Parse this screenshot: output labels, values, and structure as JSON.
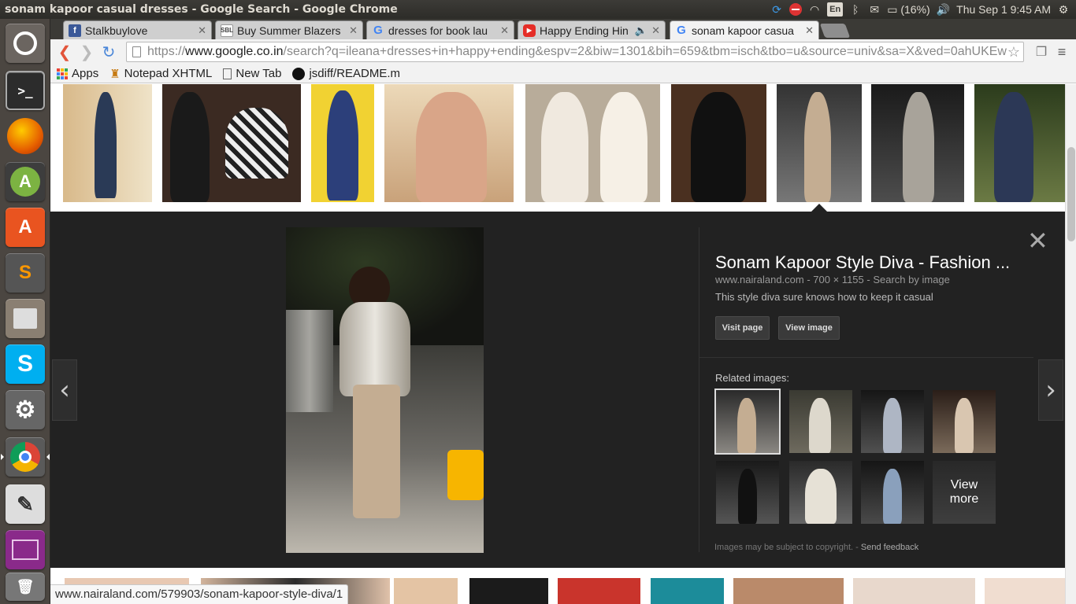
{
  "os": {
    "window_title": "sonam kapoor casual dresses - Google Search - Google Chrome",
    "tray": {
      "keyboard_layout": "En",
      "battery": "(16%)",
      "datetime": "Thu Sep  1  9:45 AM"
    }
  },
  "browser": {
    "tabs": [
      {
        "label": "Stalkbuylove",
        "favicon": "facebook-icon",
        "color": "#3b5998",
        "active": false
      },
      {
        "label": "Buy Summer Blazers",
        "favicon": "sbl-icon",
        "color": "#444444",
        "active": false
      },
      {
        "label": "dresses for book lau",
        "favicon": "google-icon",
        "color": "#4285f4",
        "active": false
      },
      {
        "label": "Happy Ending Hin",
        "favicon": "youtube-icon",
        "color": "#e52d27",
        "active": false
      },
      {
        "label": "sonam kapoor casua",
        "favicon": "google-icon",
        "color": "#4285f4",
        "active": true
      }
    ],
    "url": {
      "scheme": "https://",
      "host": "www.google.co.in",
      "path": "/search?q=ileana+dresses+in+happy+ending&espv=2&biw=1301&bih=659&tbm=isch&tbo=u&source=univ&sa=X&ved=0ahUKEw"
    },
    "bookmarks": [
      {
        "label": "Apps",
        "icon": "apps-grid-icon"
      },
      {
        "label": "Notepad XHTML",
        "icon": "notepad-icon"
      },
      {
        "label": "New Tab",
        "icon": "page-icon"
      },
      {
        "label": "jsdiff/README.m",
        "icon": "github-icon"
      }
    ],
    "status_url": "www.nairaland.com/579903/sonam-kapoor-style-diva/1"
  },
  "launcher": [
    {
      "name": "ubuntu-dash",
      "icon": "ubuntu-icon",
      "color": "#6b6560"
    },
    {
      "name": "terminal",
      "icon": "terminal-icon",
      "color": "#2c2c2c"
    },
    {
      "name": "firefox",
      "icon": "firefox-icon",
      "color": "#e66000"
    },
    {
      "name": "android-studio",
      "icon": "android-icon",
      "color": "#7cb342"
    },
    {
      "name": "software-center",
      "icon": "software-center-icon",
      "color": "#e95420"
    },
    {
      "name": "sublime-text",
      "icon": "sublime-icon",
      "color": "#555555"
    },
    {
      "name": "file-archive",
      "icon": "archive-icon",
      "color": "#8a7f72"
    },
    {
      "name": "skype",
      "icon": "skype-icon",
      "color": "#00aff0"
    },
    {
      "name": "system-settings",
      "icon": "settings-icon",
      "color": "#666666"
    },
    {
      "name": "chrome",
      "icon": "chrome-icon",
      "color": "#5a5a5a"
    },
    {
      "name": "text-editor",
      "icon": "text-editor-icon",
      "color": "#dddddd"
    },
    {
      "name": "workspace-switcher",
      "icon": "workspace-icon",
      "color": "#8a2a8a"
    },
    {
      "name": "trash",
      "icon": "trash-icon",
      "color": "#777777"
    }
  ],
  "preview": {
    "title": "Sonam Kapoor Style Diva - Fashion ...",
    "source": "www.nairaland.com",
    "dimensions": "700 × 1155",
    "search_by_image": "Search by image",
    "description": "This style diva sure knows how to keep it casual",
    "visit_page": "Visit page",
    "view_image": "View image",
    "related_label": "Related images:",
    "view_more": "View more",
    "copyright": "Images may be subject to copyright.",
    "send_feedback": "Send feedback"
  }
}
